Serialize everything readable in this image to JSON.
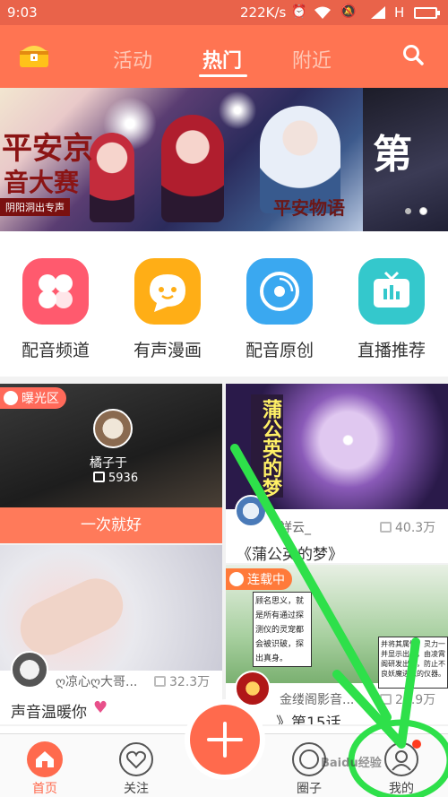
{
  "status_bar": {
    "time": "9:03",
    "speed": "222K/s",
    "network": "H"
  },
  "header": {
    "tabs": [
      {
        "label": "活动",
        "active": false
      },
      {
        "label": "热门",
        "active": true
      },
      {
        "label": "附近",
        "active": false
      }
    ],
    "logo_icon": "treasure-chest-icon",
    "search_icon": "search-icon"
  },
  "banner": {
    "title_line1": "平安京",
    "title_line2": "音大赛",
    "subtitle": "阴阳洞出专声",
    "logo_text": "平安物语",
    "next_slide_text": "第",
    "dots": 2
  },
  "categories": [
    {
      "label": "配音频道",
      "icon": "clover-icon",
      "color": "#ff5a6e"
    },
    {
      "label": "有声漫画",
      "icon": "speech-face-icon",
      "color": "#ffae16"
    },
    {
      "label": "配音原创",
      "icon": "disc-icon",
      "color": "#3aa8f0"
    },
    {
      "label": "直播推荐",
      "icon": "tv-icon",
      "color": "#34c8cc"
    }
  ],
  "feed": {
    "card1": {
      "tag": "曝光区",
      "user": "橘子于",
      "gift_count": "5936",
      "caption": "一次就好"
    },
    "card2": {
      "overlay_text": "蒲公英的梦",
      "user": "祥云_",
      "plays": "40.3万",
      "title": "《蒲公英的梦》"
    },
    "card3": {
      "user": "ღ凉心ღ大哥...",
      "plays": "32.3万",
      "title": "声音温暖你"
    },
    "card4": {
      "tag": "连载中",
      "panel_text": "顾名思义，就是所有通过探测仪的灵宠都会被识破，探出真身。",
      "side_text": "并将其属性、灵力一并显示出来，由凌霄阁研发出来，防止不良妖魔进入的仪器。",
      "user": "金缕阁影音...",
      "plays": "24.9万",
      "title": "《 ... 》第15话"
    }
  },
  "nav": {
    "items": [
      {
        "label": "首页",
        "icon": "home-icon",
        "active": true
      },
      {
        "label": "关注",
        "icon": "heart-icon",
        "active": false
      },
      {
        "label": "圈子",
        "icon": "circle-icon",
        "active": false
      },
      {
        "label": "我的",
        "icon": "user-icon",
        "active": false
      }
    ],
    "plus_icon": "plus-icon"
  },
  "colors": {
    "brand": "#ff7452",
    "status_bar": "#e9634a",
    "annotation": "#2ee04a",
    "badge": "#ff3b1f"
  },
  "watermark": "Baidu经验"
}
